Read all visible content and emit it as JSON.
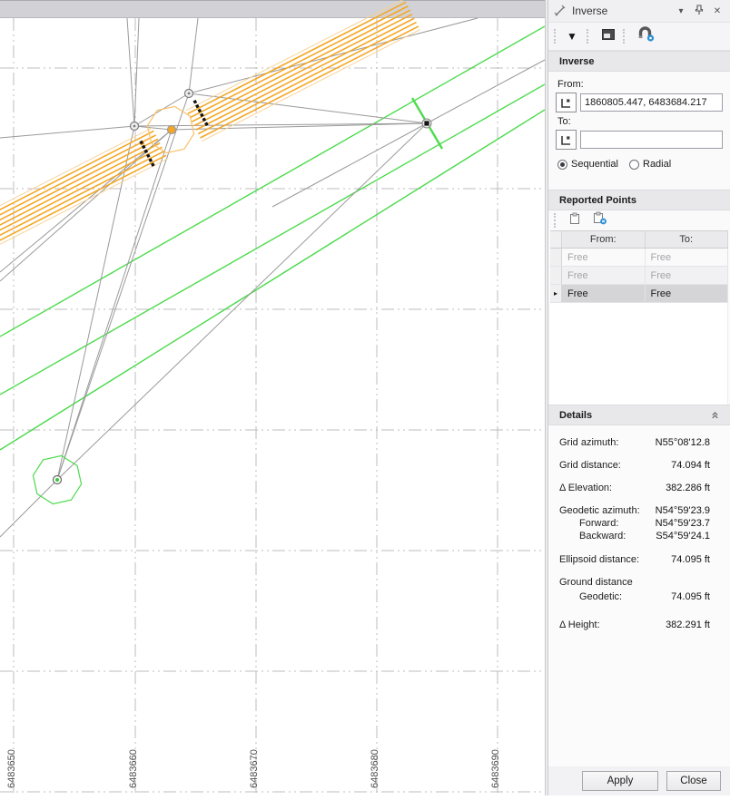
{
  "map": {
    "x_axis_labels": [
      "6483650",
      "6483660",
      "6483670",
      "6483680",
      "6483690"
    ],
    "colors": {
      "grid": "#bcbcc0",
      "survey_line": "#9a9a9a",
      "alignment_orange": "#f5a623",
      "alignment_orange_edge": "#f8cf8e",
      "corridor_green": "#4ddb4d",
      "tick_black": "#111111"
    }
  },
  "panel": {
    "title": "Inverse",
    "titlebar_icons": {
      "dropdown": "▾",
      "close": "✕"
    },
    "toolbar_icons": {
      "dropdown": "▼"
    },
    "inverse_section": {
      "header": "Inverse",
      "from_label": "From:",
      "from_value": "1860805.447, 6483684.217",
      "to_label": "To:",
      "to_value": "",
      "mode_options": [
        {
          "label": "Sequential",
          "selected": true
        },
        {
          "label": "Radial",
          "selected": false
        }
      ]
    },
    "reported_points": {
      "header": "Reported Points",
      "columns": [
        "From:",
        "To:"
      ],
      "row_marker": "▸",
      "rows": [
        {
          "from": "Free",
          "to": "Free",
          "state": "normal"
        },
        {
          "from": "Free",
          "to": "Free",
          "state": "alt"
        },
        {
          "from": "Free",
          "to": "Free",
          "state": "selected"
        }
      ]
    },
    "details": {
      "header": "Details",
      "rows": [
        {
          "label": "Grid azimuth:",
          "value": "N55°08'12.8"
        },
        {
          "label": "Grid distance:",
          "value": "74.094 ft"
        },
        {
          "label": "Δ Elevation:",
          "value": "382.286 ft"
        },
        {
          "label": "Geodetic azimuth:",
          "value": "N54°59'23.9"
        },
        {
          "label": "Forward:",
          "value": "N54°59'23.7"
        },
        {
          "label": "Backward:",
          "value": "S54°59'24.1"
        },
        {
          "label": "Ellipsoid distance:",
          "value": "74.095 ft"
        },
        {
          "label": "Ground distance",
          "value": ""
        },
        {
          "label": "Geodetic:",
          "value": "74.095 ft"
        },
        {
          "label": "Δ Height:",
          "value": "382.291 ft"
        }
      ]
    },
    "buttons": {
      "apply": "Apply",
      "close": "Close"
    }
  }
}
